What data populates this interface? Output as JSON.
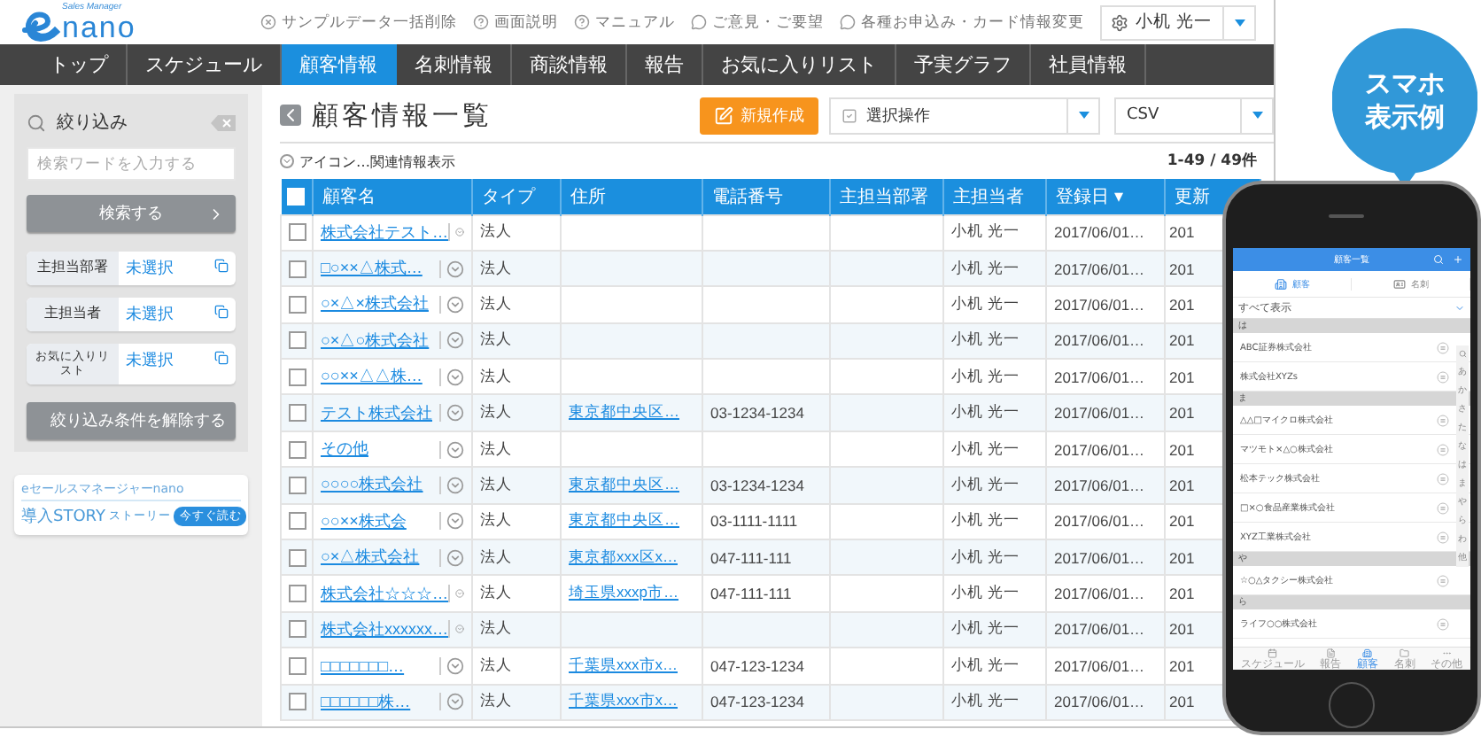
{
  "logo": {
    "tagline": "Sales Manager",
    "name": "nano"
  },
  "header_links": [
    {
      "kind": "delete",
      "label": "サンプルデータ一括削除"
    },
    {
      "kind": "help",
      "label": "画面説明"
    },
    {
      "kind": "help",
      "label": "マニュアル"
    },
    {
      "kind": "comment",
      "label": "ご意見・ご要望"
    },
    {
      "kind": "comment",
      "label": "各種お申込み・カード情報変更"
    }
  ],
  "user_menu": {
    "name": "小机 光一"
  },
  "nav": [
    {
      "label": "トップ",
      "selected": false
    },
    {
      "label": "スケジュール",
      "selected": false
    },
    {
      "label": "顧客情報",
      "selected": true
    },
    {
      "label": "名刺情報",
      "selected": false
    },
    {
      "label": "商談情報",
      "selected": false
    },
    {
      "label": "報告",
      "selected": false
    },
    {
      "label": "お気に入りリスト",
      "selected": false
    },
    {
      "label": "予実グラフ",
      "selected": false
    },
    {
      "label": "社員情報",
      "selected": false
    }
  ],
  "sidebar": {
    "title": "絞り込み",
    "search": {
      "placeholder": "検索ワードを入力する"
    },
    "search_button": "検索する",
    "filters": [
      {
        "label": "主担当部署",
        "value": "未選択"
      },
      {
        "label": "主担当者",
        "value": "未選択"
      },
      {
        "label": "お気に入りリスト",
        "value": "未選択"
      }
    ],
    "clear_button": "絞り込み条件を解除する",
    "banner": {
      "caption": "eセールスマネージャーnano",
      "title": "導入STORY",
      "subtitle": "ストーリー",
      "button": "今すぐ読む"
    }
  },
  "page": {
    "title": "顧客情報一覧",
    "new_button": "新規作成",
    "bulk_select": "選択操作",
    "export_select": "CSV",
    "icon_toggle": "アイコン…関連情報表示",
    "count": "1-49 / 49件"
  },
  "table": {
    "header_checked": false,
    "columns": [
      "顧客名",
      "タイプ",
      "住所",
      "電話番号",
      "主担当部署",
      "主担当者",
      "登録日 ▾",
      "更新"
    ],
    "rows": [
      {
        "checked": false,
        "name": "株式会社テスト…",
        "type": "法人",
        "owner": "小机 光一",
        "registered": "2017/06/01…",
        "updated": "201"
      },
      {
        "checked": false,
        "name": "□○××△株式…",
        "type": "法人",
        "owner": "小机 光一",
        "registered": "2017/06/01…",
        "updated": "201"
      },
      {
        "checked": false,
        "name": "○×△×株式会社",
        "type": "法人",
        "owner": "小机 光一",
        "registered": "2017/06/01…",
        "updated": "201"
      },
      {
        "checked": false,
        "name": "○×△○株式会社",
        "type": "法人",
        "owner": "小机 光一",
        "registered": "2017/06/01…",
        "updated": "201"
      },
      {
        "checked": false,
        "name": "○○××△△株…",
        "type": "法人",
        "owner": "小机 光一",
        "registered": "2017/06/01…",
        "updated": "201"
      },
      {
        "checked": false,
        "name": "テスト株式会社",
        "type": "法人",
        "address": "東京都中央区…",
        "phone": "03-1234-1234",
        "owner": "小机 光一",
        "registered": "2017/06/01…",
        "updated": "201"
      },
      {
        "checked": false,
        "name": "その他",
        "type": "法人",
        "owner": "小机 光一",
        "registered": "2017/06/01…",
        "updated": "201"
      },
      {
        "checked": false,
        "name": "○○○○株式会社",
        "type": "法人",
        "address": "東京都中央区…",
        "phone": "03-1234-1234",
        "owner": "小机 光一",
        "registered": "2017/06/01…",
        "updated": "201"
      },
      {
        "checked": false,
        "name": "○○××株式会",
        "type": "法人",
        "address": "東京都中央区…",
        "phone": "03-1111-1111",
        "owner": "小机 光一",
        "registered": "2017/06/01…",
        "updated": "201"
      },
      {
        "checked": false,
        "name": "○×△株式会社",
        "type": "法人",
        "address": "東京都xxx区x…",
        "phone": "047-111-111",
        "owner": "小机 光一",
        "registered": "2017/06/01…",
        "updated": "201"
      },
      {
        "checked": false,
        "name": "株式会社☆☆☆…",
        "type": "法人",
        "address": "埼玉県xxxp市…",
        "phone": "047-111-111",
        "owner": "小机 光一",
        "registered": "2017/06/01…",
        "updated": "201"
      },
      {
        "checked": false,
        "name": "株式会社xxxxxx…",
        "type": "法人",
        "owner": "小机 光一",
        "registered": "2017/06/01…",
        "updated": "201"
      },
      {
        "checked": false,
        "name": "□□□□□□□…",
        "type": "法人",
        "address": "千葉県xxx市x…",
        "phone": "047-123-1234",
        "owner": "小机 光一",
        "registered": "2017/06/01…",
        "updated": "201"
      },
      {
        "checked": false,
        "name": "□□□□□□株…",
        "type": "法人",
        "address": "千葉県xxx市x…",
        "phone": "047-123-1234",
        "owner": "小机 光一",
        "registered": "2017/06/01…",
        "updated": "201"
      }
    ]
  },
  "callout": {
    "lines": [
      "スマホ",
      "表示例"
    ]
  },
  "phone": {
    "title": "顧客一覧",
    "tabs": [
      {
        "label": "顧客",
        "selected": true
      },
      {
        "label": "名刺",
        "selected": false
      }
    ],
    "filter": "すべて表示",
    "sections": [
      {
        "heading": "は",
        "items": [
          "ABC証券株式会社",
          "株式会社XYZs"
        ]
      },
      {
        "heading": "ま",
        "items": [
          "△△□マイクロ株式会社",
          "マツモト×△○株式会社",
          "松本テック株式会社",
          "□×○食品産業株式会社",
          "XYZ工業株式会社"
        ]
      },
      {
        "heading": "や",
        "items": [
          "☆○△タクシー株式会社"
        ]
      },
      {
        "heading": "ら",
        "items": [
          "ライフ○○株式会社"
        ]
      }
    ],
    "index": [
      "あ",
      "か",
      "さ",
      "た",
      "な",
      "は",
      "ま",
      "や",
      "ら",
      "わ",
      "他"
    ],
    "bottom_tabs": [
      {
        "kind": "calendar",
        "label": "スケジュール",
        "selected": false
      },
      {
        "kind": "report",
        "label": "報告",
        "selected": false
      },
      {
        "kind": "customer",
        "label": "顧客",
        "selected": true
      },
      {
        "kind": "card",
        "label": "名刺",
        "selected": false
      },
      {
        "kind": "more",
        "label": "その他",
        "selected": false
      }
    ]
  }
}
